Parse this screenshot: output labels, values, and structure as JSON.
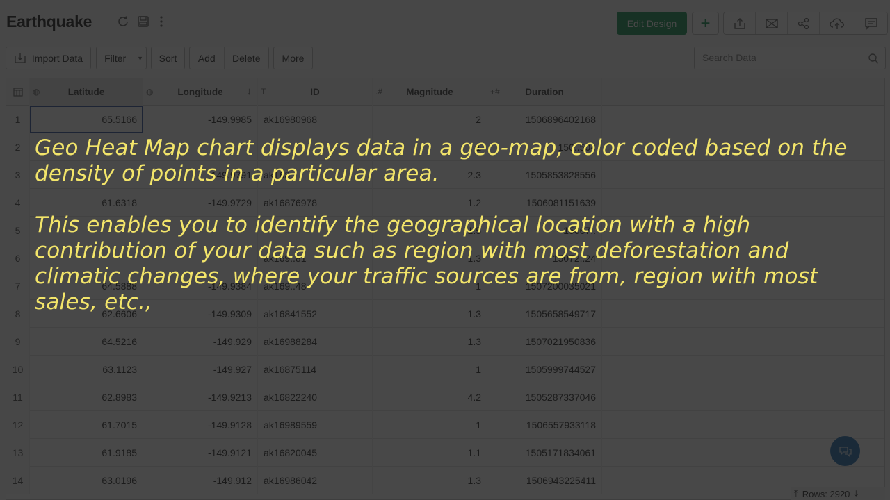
{
  "header": {
    "title": "Earthquake",
    "edit_design_label": "Edit Design",
    "icons": [
      "refresh-icon",
      "save-icon",
      "more-vertical-icon",
      "plus-icon",
      "export-icon",
      "email-icon",
      "share-icon",
      "cloud-upload-icon",
      "comment-icon"
    ]
  },
  "toolbar": {
    "import_label": "Import Data",
    "filter_label": "Filter",
    "sort_label": "Sort",
    "add_label": "Add",
    "delete_label": "Delete",
    "more_label": "More",
    "search_placeholder": "Search Data"
  },
  "colors": {
    "accent": "#0b8a4a",
    "caption": "#f3e56a",
    "chat_button": "#1a6ab0",
    "selection": "#2a4a9a"
  },
  "grid": {
    "columns": [
      {
        "label": "Latitude",
        "type_icon": "globe-icon"
      },
      {
        "label": "Longitude",
        "type_icon": "globe-icon",
        "sorted": "descending"
      },
      {
        "label": "ID",
        "type_icon": "T"
      },
      {
        "label": "Magnitude",
        "type_icon": ".#"
      },
      {
        "label": "Duration",
        "type_icon": "+#"
      }
    ],
    "rows": [
      {
        "n": "1",
        "lat": "65.5166",
        "lon": "-149.9985",
        "id": "ak16980968",
        "mag": "2",
        "dur": "1506896402168"
      },
      {
        "n": "2",
        "lat": "",
        "lon": "",
        "id": "",
        "mag": "1",
        "dur": "150..504"
      },
      {
        "n": "3",
        "lat": "",
        "lon": "-149.9791",
        "id": "ak168..",
        "mag": "2.3",
        "dur": "1505853828556"
      },
      {
        "n": "4",
        "lat": "61.6318",
        "lon": "-149.9729",
        "id": "ak16876978",
        "mag": "1.2",
        "dur": "1506081151639"
      },
      {
        "n": "5",
        "lat": "",
        "lon": "",
        "id": "",
        "mag": "1.5",
        "dur": "15067.."
      },
      {
        "n": "6",
        "lat": "",
        "lon": "",
        "id": "ak169..81",
        "mag": "1.3",
        "dur": "15072..24"
      },
      {
        "n": "7",
        "lat": "64.5888",
        "lon": "-149.9384",
        "id": "ak169..48",
        "mag": "1",
        "dur": "1507200035021"
      },
      {
        "n": "8",
        "lat": "62.6606",
        "lon": "-149.9309",
        "id": "ak16841552",
        "mag": "1.3",
        "dur": "1505658549717"
      },
      {
        "n": "9",
        "lat": "64.5216",
        "lon": "-149.929",
        "id": "ak16988284",
        "mag": "1.3",
        "dur": "1507021950836"
      },
      {
        "n": "10",
        "lat": "63.1123",
        "lon": "-149.927",
        "id": "ak16875114",
        "mag": "1",
        "dur": "1505999744527"
      },
      {
        "n": "11",
        "lat": "62.8983",
        "lon": "-149.9213",
        "id": "ak16822240",
        "mag": "4.2",
        "dur": "1505287337046"
      },
      {
        "n": "12",
        "lat": "61.7015",
        "lon": "-149.9128",
        "id": "ak16989559",
        "mag": "1",
        "dur": "1506557933118"
      },
      {
        "n": "13",
        "lat": "61.9185",
        "lon": "-149.9121",
        "id": "ak16820045",
        "mag": "1.1",
        "dur": "1505171834061"
      },
      {
        "n": "14",
        "lat": "63.0196",
        "lon": "-149.912",
        "id": "ak16986042",
        "mag": "1.3",
        "dur": "1506943225411"
      }
    ],
    "rows_count_label": "Rows: 2920"
  },
  "overlay": {
    "paragraph1": "Geo Heat Map chart displays data in a geo-map, color coded based on the density of points in a particular area.",
    "paragraph2": "This enables you to identify the geographical location with a high contribution of your data such as region with most deforestation and climatic changes, where your traffic sources are from, region with most sales, etc.,"
  }
}
